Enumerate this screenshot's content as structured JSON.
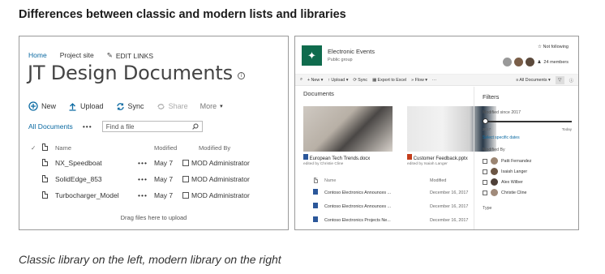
{
  "heading": "Differences between classic and modern lists and libraries",
  "caption": "Classic library on the left, modern library on the right",
  "classic": {
    "nav": {
      "home": "Home",
      "project": "Project site",
      "edit": "EDIT LINKS"
    },
    "title": "JT Design Documents",
    "commands": {
      "new": "New",
      "upload": "Upload",
      "sync": "Sync",
      "share": "Share",
      "more": "More"
    },
    "view": {
      "all": "All Documents",
      "dots": "•••",
      "find_placeholder": "Find a file"
    },
    "columns": {
      "name": "Name",
      "modified": "Modified",
      "modified_by": "Modified By"
    },
    "rows": [
      {
        "name": "NX_Speedboat",
        "modified": "May 7",
        "by": "MOD Administrator"
      },
      {
        "name": "SolidEdge_853",
        "modified": "May 7",
        "by": "MOD Administrator"
      },
      {
        "name": "Turbocharger_Model",
        "modified": "May 7",
        "by": "MOD Administrator"
      }
    ],
    "drag_hint": "Drag files here to upload"
  },
  "modern": {
    "site_name": "Electronic Events",
    "site_sub": "Public group",
    "follow": "Not following",
    "members": "24 members",
    "commands": {
      "new": "New",
      "upload": "Upload",
      "sync": "Sync",
      "export": "Export to Excel",
      "flow": "Flow",
      "view": "All Documents"
    },
    "docs_title": "Documents",
    "tiles": [
      {
        "name": "European Tech Trends.docx",
        "by": "edited by Christie Cline"
      },
      {
        "name": "Customer Feedback.pptx",
        "by": "edited by Isaiah Langer"
      }
    ],
    "list_cols": {
      "name": "Name",
      "modified": "Modified"
    },
    "list_rows": [
      {
        "name": "Contoso Electronics Announces ...",
        "modified": "December 16, 2017"
      },
      {
        "name": "Contoso Electronics Announces ...",
        "modified": "December 16, 2017"
      },
      {
        "name": "Contoso Electronics Projects Ne...",
        "modified": "December 16, 2017"
      }
    ],
    "filters": {
      "title": "Filters",
      "modified_label": "Modified since 2017",
      "date_start": "2017",
      "date_end": "Today",
      "select_dates": "Select specific dates",
      "modified_by_label": "Modified By",
      "people": [
        "Patti Fernandez",
        "Isaiah Langer",
        "Alex Wilber",
        "Christie Cline"
      ],
      "type_label": "Type"
    }
  }
}
